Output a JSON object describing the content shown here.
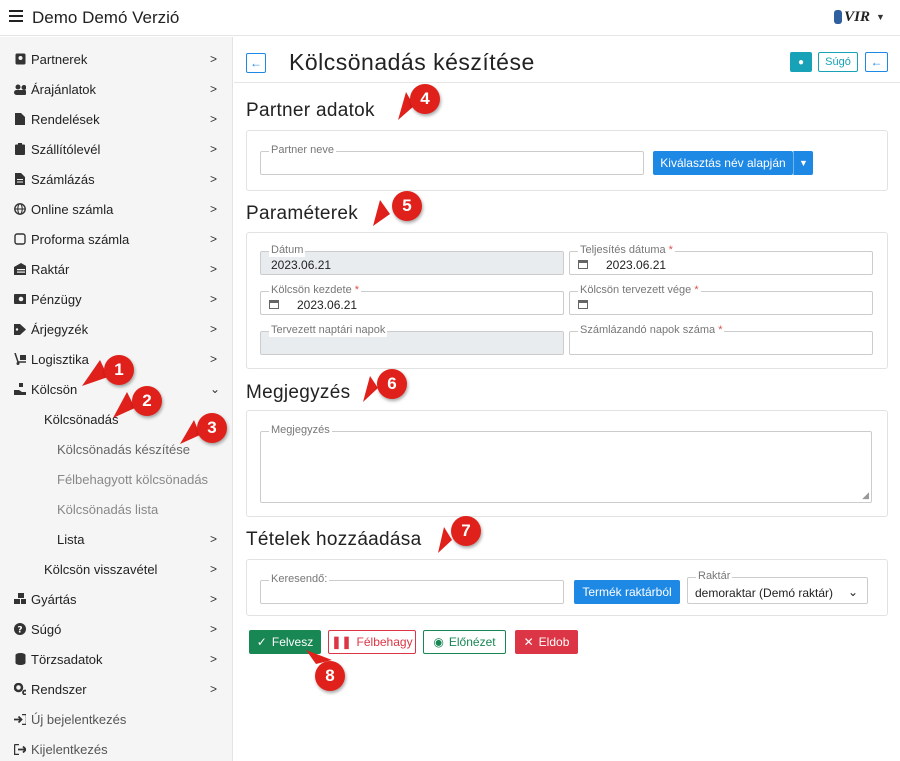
{
  "app": {
    "title": "Demo Demó Verzió",
    "logo_text": "VIR"
  },
  "sidebar": {
    "items": [
      {
        "label": "Partnerek",
        "icon": "address-card-icon"
      },
      {
        "label": "Árajánlatok",
        "icon": "users-icon"
      },
      {
        "label": "Rendelések",
        "icon": "file-icon"
      },
      {
        "label": "Szállítólevél",
        "icon": "clipboard-icon"
      },
      {
        "label": "Számlázás",
        "icon": "invoice-icon"
      },
      {
        "label": "Online számla",
        "icon": "globe-icon"
      },
      {
        "label": "Proforma számla",
        "icon": "square-icon"
      },
      {
        "label": "Raktár",
        "icon": "warehouse-icon"
      },
      {
        "label": "Pénzügy",
        "icon": "money-icon"
      },
      {
        "label": "Árjegyzék",
        "icon": "tags-icon"
      },
      {
        "label": "Logisztika",
        "icon": "dolly-icon"
      },
      {
        "label": "Kölcsön",
        "icon": "hand-holding-icon"
      },
      {
        "label": "Kölcsönadás"
      },
      {
        "label": "Kölcsönadás készítése"
      },
      {
        "label": "Félbehagyott kölcsönadás"
      },
      {
        "label": "Kölcsönadás lista"
      },
      {
        "label": "Lista"
      },
      {
        "label": "Kölcsön visszavétel"
      },
      {
        "label": "Gyártás",
        "icon": "cubes-icon"
      },
      {
        "label": "Súgó",
        "icon": "question-circle-icon"
      },
      {
        "label": "Törzsadatok",
        "icon": "database-icon"
      },
      {
        "label": "Rendszer",
        "icon": "cogs-icon"
      },
      {
        "label": "Új bejelentkezés",
        "icon": "sign-in-icon"
      },
      {
        "label": "Kijelentkezés",
        "icon": "sign-out-icon"
      }
    ]
  },
  "header": {
    "title": "Kölcsönadás készítése",
    "help_label": "Súgó"
  },
  "sections": {
    "partner": {
      "title": "Partner adatok",
      "partner_name_label": "Partner neve",
      "partner_name_value": "",
      "select_button": "Kiválasztás név alapján"
    },
    "params": {
      "title": "Paraméterek",
      "date_label": "Dátum",
      "date_value": "2023.06.21",
      "completion_label": "Teljesítés dátuma",
      "completion_value": "2023.06.21",
      "loan_start_label": "Kölcsön kezdete",
      "loan_start_value": "2023.06.21",
      "loan_end_label": "Kölcsön tervezett vége",
      "loan_end_value": "",
      "planned_days_label": "Tervezett naptári napok",
      "billable_days_label": "Számlázandó napok száma",
      "required_mark": "*"
    },
    "note": {
      "title": "Megjegyzés",
      "field_label": "Megjegyzés"
    },
    "items": {
      "title": "Tételek hozzáadása",
      "search_label": "Keresendő:",
      "stock_button": "Termék raktárból",
      "warehouse_label": "Raktár",
      "warehouse_value": "demoraktar (Demó raktár)"
    }
  },
  "actions": {
    "save": "Felvesz",
    "pause": "Félbehagy",
    "preview": "Előnézet",
    "discard": "Eldob"
  },
  "markers": [
    "1",
    "2",
    "3",
    "4",
    "5",
    "6",
    "7",
    "8"
  ],
  "colors": {
    "primary": "#1e88e5",
    "success": "#198754",
    "danger": "#dc3545",
    "info": "#17a2b8",
    "marker": "#e0201a",
    "sidebar_bg": "#f5f5f5"
  }
}
